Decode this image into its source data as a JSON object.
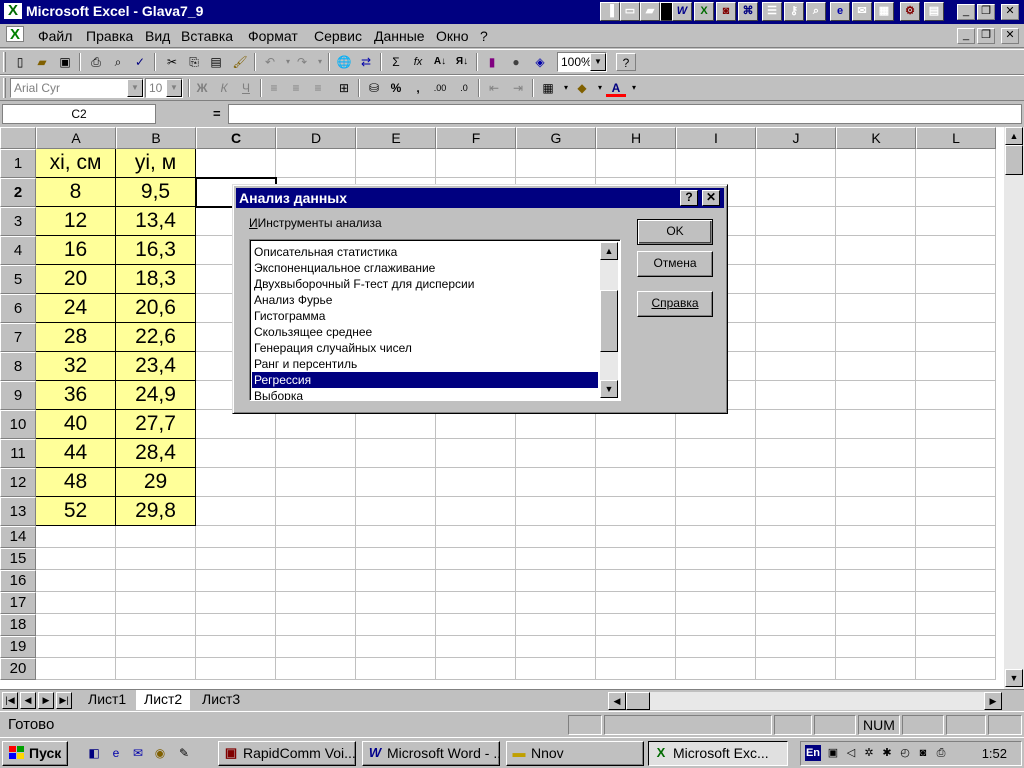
{
  "window": {
    "title": "Microsoft Excel - Glava7_9",
    "minimize": "_",
    "restore": "❐",
    "close": "✕"
  },
  "menu": {
    "items": [
      "Файл",
      "Правка",
      "Вид",
      "Вставка",
      "Формат",
      "Сервис",
      "Данные",
      "Окно",
      "?"
    ],
    "doc_minimize": "_",
    "doc_restore": "❐",
    "doc_close": "✕"
  },
  "toolbar": {
    "zoom": "100%",
    "font_name": "Arial Cyr",
    "font_size": "10",
    "bold": "Ж",
    "italic": "К",
    "underline": "Ч",
    "percent": "%",
    "comma": ",",
    "autosum": "Σ",
    "function": "fx"
  },
  "formula_bar": {
    "name_box": "C2",
    "equals": "=",
    "formula": ""
  },
  "sheet": {
    "column_headers": [
      "A",
      "B",
      "C",
      "D",
      "E",
      "F",
      "G",
      "H",
      "I",
      "J",
      "K",
      "L"
    ],
    "row_headers": [
      "1",
      "2",
      "3",
      "4",
      "5",
      "6",
      "7",
      "8",
      "9",
      "10",
      "11",
      "12",
      "13",
      "14",
      "15",
      "16",
      "17",
      "18",
      "19",
      "20"
    ],
    "header_x": "xi, см",
    "header_y": "yi, м",
    "x_values": [
      "8",
      "12",
      "16",
      "20",
      "24",
      "28",
      "32",
      "36",
      "40",
      "44",
      "48",
      "52"
    ],
    "y_values": [
      "9,5",
      "13,4",
      "16,3",
      "18,3",
      "20,6",
      "22,6",
      "23,4",
      "24,9",
      "27,7",
      "28,4",
      "29",
      "29,8"
    ],
    "active_cell": "C2",
    "active_column": "C",
    "active_row": "2",
    "highlight_color": "#ffff99"
  },
  "tabs": {
    "sheets": [
      "Лист1",
      "Лист2",
      "Лист3"
    ],
    "active": "Лист2"
  },
  "status": {
    "text": "Готово",
    "num": "NUM"
  },
  "taskbar": {
    "start": "Пуск",
    "buttons": [
      "RapidComm Voi...",
      "Microsoft Word - ...",
      "Nnov",
      "Microsoft Exc..."
    ],
    "active_button": "Microsoft Exc...",
    "lang": "En",
    "clock": "1:52"
  },
  "dialog": {
    "title": "Анализ данных",
    "help_btn": "?",
    "close_btn": "✕",
    "label": "Инструменты анализа",
    "items": [
      "Описательная статистика",
      "Экспоненциальное сглаживание",
      "Двухвыборочный F-тест для дисперсии",
      "Анализ Фурье",
      "Гистограмма",
      "Скользящее среднее",
      "Генерация случайных чисел",
      "Ранг и персентиль",
      "Регрессия",
      "Выборка"
    ],
    "selected": "Регрессия",
    "ok": "OK",
    "cancel": "Отмена",
    "help": "Справка"
  }
}
